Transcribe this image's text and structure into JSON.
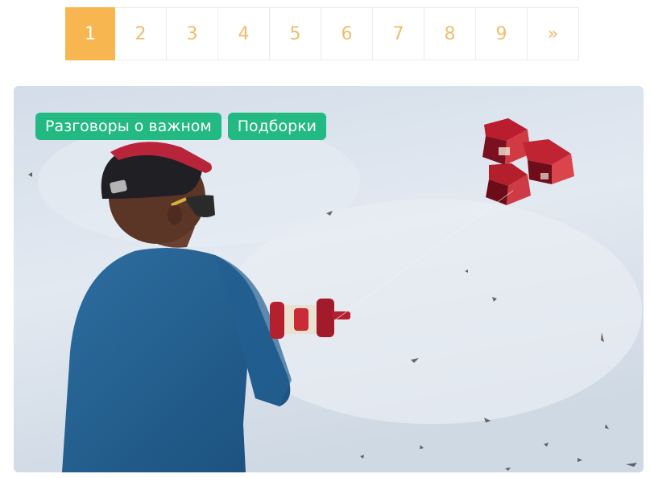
{
  "pagination": {
    "pages": [
      "1",
      "2",
      "3",
      "4",
      "5",
      "6",
      "7",
      "8",
      "9"
    ],
    "next": "»",
    "current": "1"
  },
  "card": {
    "tags": [
      "Разговоры о важном",
      "Подборки"
    ],
    "image": "boy-flying-kite-photo"
  },
  "colors": {
    "accent": "#f7b64f",
    "tag": "#23b982"
  }
}
